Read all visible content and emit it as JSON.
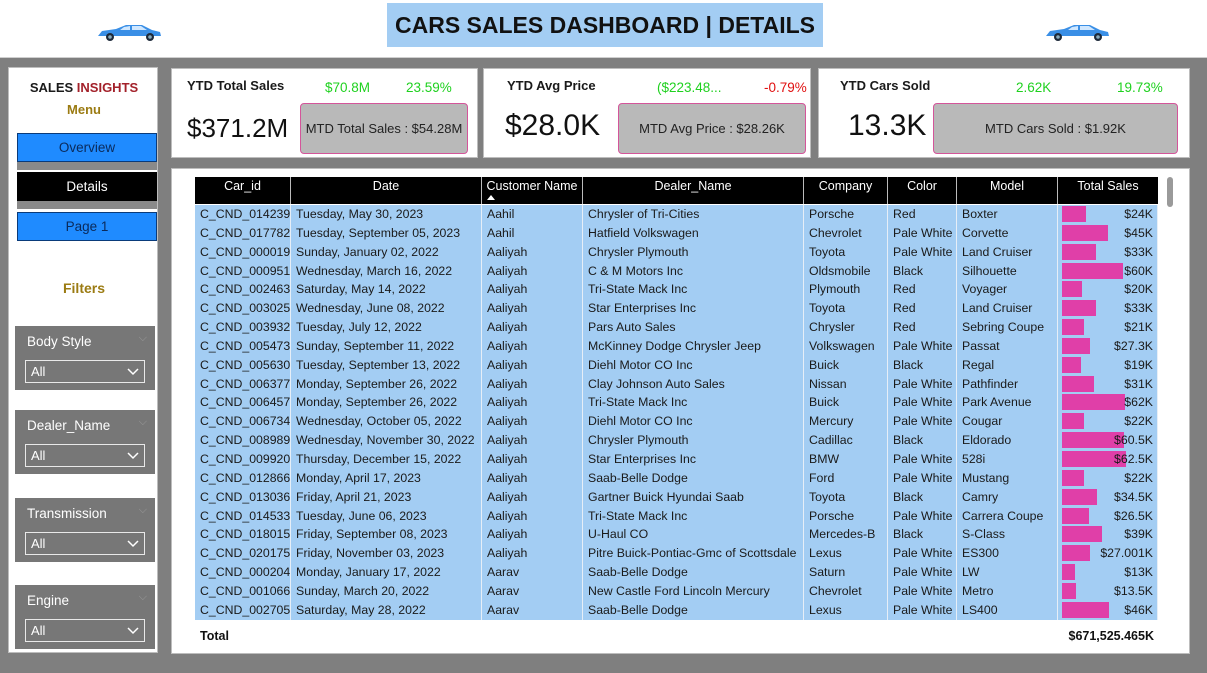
{
  "header": {
    "title": "CARS SALES DASHBOARD | DETAILS"
  },
  "sidebar": {
    "brand_a": "SALES ",
    "brand_b": "INSIGHTS",
    "menu": "Menu",
    "nav": {
      "overview": "Overview",
      "details": "Details",
      "page1": "Page 1"
    },
    "filters_label": "Filters",
    "slicers": [
      {
        "title": "Body Style",
        "value": "All"
      },
      {
        "title": "Dealer_Name",
        "value": "All"
      },
      {
        "title": "Transmission",
        "value": "All"
      },
      {
        "title": "Engine",
        "value": "All"
      }
    ]
  },
  "kpis": {
    "sales": {
      "title": "YTD Total Sales",
      "value": "$371.2M",
      "delta_value": "$70.8M",
      "delta_pct": "23.59%",
      "mtd": "MTD Total Sales : $54.28M"
    },
    "price": {
      "title": "YTD Avg Price",
      "value": "$28.0K",
      "delta_value": "($223.48...",
      "delta_pct": "-0.79%",
      "mtd": "MTD Avg Price : $28.26K"
    },
    "cars": {
      "title": "YTD Cars Sold",
      "value": "13.3K",
      "delta_value": "2.62K",
      "delta_pct": "19.73%",
      "mtd": "MTD Cars Sold : $1.92K"
    }
  },
  "colors": {
    "accent_blue": "#a3cdf3",
    "bar_pink": "#e03fa8",
    "green": "#1fd11f",
    "red": "#e01010"
  },
  "table": {
    "columns": [
      "Car_id",
      "Date",
      "Customer Name",
      "Dealer_Name",
      "Company",
      "Color",
      "Model",
      "Total Sales"
    ],
    "sorted_column": "Customer Name",
    "rows": [
      [
        "C_CND_014239",
        "Tuesday, May 30, 2023",
        "Aahil",
        "Chrysler of Tri-Cities",
        "Porsche",
        "Red",
        "Boxter",
        "$24K",
        0.38
      ],
      [
        "C_CND_017782",
        "Tuesday, September 05, 2023",
        "Aahil",
        "Hatfield Volkswagen",
        "Chevrolet",
        "Pale White",
        "Corvette",
        "$45K",
        0.72
      ],
      [
        "C_CND_000019",
        "Sunday, January 02, 2022",
        "Aaliyah",
        "Chrysler Plymouth",
        "Toyota",
        "Pale White",
        "Land Cruiser",
        "$33K",
        0.53
      ],
      [
        "C_CND_000951",
        "Wednesday, March 16, 2022",
        "Aaliyah",
        "C & M Motors Inc",
        "Oldsmobile",
        "Black",
        "Silhouette",
        "$60K",
        0.96
      ],
      [
        "C_CND_002463",
        "Saturday, May 14, 2022",
        "Aaliyah",
        "Tri-State Mack Inc",
        "Plymouth",
        "Red",
        "Voyager",
        "$20K",
        0.32
      ],
      [
        "C_CND_003025",
        "Wednesday, June 08, 2022",
        "Aaliyah",
        "Star Enterprises Inc",
        "Toyota",
        "Red",
        "Land Cruiser",
        "$33K",
        0.53
      ],
      [
        "C_CND_003932",
        "Tuesday, July 12, 2022",
        "Aaliyah",
        "Pars Auto Sales",
        "Chrysler",
        "Red",
        "Sebring Coupe",
        "$21K",
        0.34
      ],
      [
        "C_CND_005473",
        "Sunday, September 11, 2022",
        "Aaliyah",
        "McKinney Dodge Chrysler Jeep",
        "Volkswagen",
        "Pale White",
        "Passat",
        "$27.3K",
        0.44
      ],
      [
        "C_CND_005630",
        "Tuesday, September 13, 2022",
        "Aaliyah",
        "Diehl Motor CO Inc",
        "Buick",
        "Black",
        "Regal",
        "$19K",
        0.3
      ],
      [
        "C_CND_006377",
        "Monday, September 26, 2022",
        "Aaliyah",
        "Clay Johnson Auto Sales",
        "Nissan",
        "Pale White",
        "Pathfinder",
        "$31K",
        0.5
      ],
      [
        "C_CND_006457",
        "Monday, September 26, 2022",
        "Aaliyah",
        "Tri-State Mack Inc",
        "Buick",
        "Pale White",
        "Park Avenue",
        "$62K",
        0.99
      ],
      [
        "C_CND_006734",
        "Wednesday, October 05, 2022",
        "Aaliyah",
        "Diehl Motor CO Inc",
        "Mercury",
        "Pale White",
        "Cougar",
        "$22K",
        0.35
      ],
      [
        "C_CND_008989",
        "Wednesday, November 30, 2022",
        "Aaliyah",
        "Chrysler Plymouth",
        "Cadillac",
        "Black",
        "Eldorado",
        "$60.5K",
        0.97
      ],
      [
        "C_CND_009920",
        "Thursday, December 15, 2022",
        "Aaliyah",
        "Star Enterprises Inc",
        "BMW",
        "Pale White",
        "528i",
        "$62.5K",
        1.0
      ],
      [
        "C_CND_012866",
        "Monday, April 17, 2023",
        "Aaliyah",
        "Saab-Belle Dodge",
        "Ford",
        "Pale White",
        "Mustang",
        "$22K",
        0.35
      ],
      [
        "C_CND_013036",
        "Friday, April 21, 2023",
        "Aaliyah",
        "Gartner Buick Hyundai Saab",
        "Toyota",
        "Black",
        "Camry",
        "$34.5K",
        0.55
      ],
      [
        "C_CND_014533",
        "Tuesday, June 06, 2023",
        "Aaliyah",
        "Tri-State Mack Inc",
        "Porsche",
        "Pale White",
        "Carrera Coupe",
        "$26.5K",
        0.42
      ],
      [
        "C_CND_018015",
        "Friday, September 08, 2023",
        "Aaliyah",
        "U-Haul CO",
        "Mercedes-B",
        "Black",
        "S-Class",
        "$39K",
        0.62
      ],
      [
        "C_CND_020175",
        "Friday, November 03, 2023",
        "Aaliyah",
        "Pitre Buick-Pontiac-Gmc of Scottsdale",
        "Lexus",
        "Pale White",
        "ES300",
        "$27.001K",
        0.43
      ],
      [
        "C_CND_000204",
        "Monday, January 17, 2022",
        "Aarav",
        "Saab-Belle Dodge",
        "Saturn",
        "Pale White",
        "LW",
        "$13K",
        0.21
      ],
      [
        "C_CND_001066",
        "Sunday, March 20, 2022",
        "Aarav",
        "New Castle Ford Lincoln Mercury",
        "Chevrolet",
        "Pale White",
        "Metro",
        "$13.5K",
        0.22
      ],
      [
        "C_CND_002705",
        "Saturday, May 28, 2022",
        "Aarav",
        "Saab-Belle Dodge",
        "Lexus",
        "Pale White",
        "LS400",
        "$46K",
        0.74
      ]
    ],
    "total_label": "Total",
    "total_value": "$671,525.465K"
  }
}
